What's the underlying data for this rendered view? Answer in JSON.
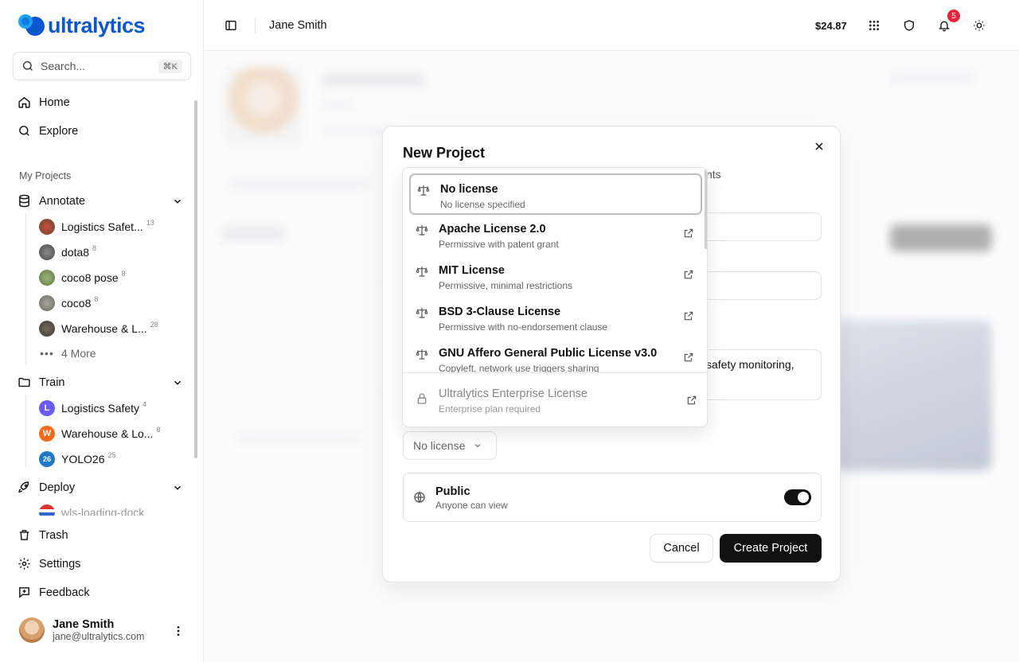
{
  "brand": {
    "name": "ultralytics"
  },
  "search": {
    "placeholder": "Search...",
    "shortcut": "⌘K"
  },
  "nav": {
    "home": "Home",
    "explore": "Explore",
    "trash": "Trash",
    "settings": "Settings",
    "feedback": "Feedback"
  },
  "projects": {
    "section_label": "My Projects",
    "annotate": {
      "label": "Annotate",
      "items": [
        {
          "label": "Logistics Safet...",
          "count": "13"
        },
        {
          "label": "dota8",
          "count": "8"
        },
        {
          "label": "coco8 pose",
          "count": "8"
        },
        {
          "label": "coco8",
          "count": "8"
        },
        {
          "label": "Warehouse & L...",
          "count": "28"
        }
      ],
      "more": "4 More"
    },
    "train": {
      "label": "Train",
      "items": [
        {
          "letter": "L",
          "label": "Logistics Safety",
          "count": "4",
          "color": "#6b5cf0"
        },
        {
          "letter": "W",
          "label": "Warehouse & Lo...",
          "count": "8",
          "color": "#f26a1b"
        },
        {
          "letter": "26",
          "label": "YOLO26",
          "count": "25",
          "color": "#1f78c8"
        }
      ]
    },
    "deploy": {
      "label": "Deploy",
      "items": [
        {
          "label": "wls-loading-dock"
        }
      ]
    }
  },
  "user": {
    "name": "Jane Smith",
    "email": "jane@ultralytics.com"
  },
  "topbar": {
    "title": "Jane Smith",
    "balance": "$24.87",
    "notifications": "5"
  },
  "modal": {
    "title": "New Project",
    "behind_text": "nts",
    "description_partial": "safety monitoring,",
    "license_select": "No license",
    "public": {
      "title": "Public",
      "subtitle": "Anyone can view",
      "enabled": true
    },
    "cancel": "Cancel",
    "create": "Create Project"
  },
  "license_options": [
    {
      "title": "No license",
      "subtitle": "No license specified",
      "selected": true,
      "external": false
    },
    {
      "title": "Apache License 2.0",
      "subtitle": "Permissive with patent grant",
      "external": true
    },
    {
      "title": "MIT License",
      "subtitle": "Permissive, minimal restrictions",
      "external": true
    },
    {
      "title": "BSD 3-Clause License",
      "subtitle": "Permissive with no-endorsement clause",
      "external": true
    },
    {
      "title": "GNU Affero General Public License v3.0",
      "subtitle": "Copyleft, network use triggers sharing",
      "external": true
    }
  ],
  "enterprise_option": {
    "title": "Ultralytics Enterprise License",
    "subtitle": "Enterprise plan required",
    "disabled": true
  },
  "colors": {
    "brand": "#0b57d0",
    "accent": "#111111",
    "badge": "#e5253b"
  }
}
